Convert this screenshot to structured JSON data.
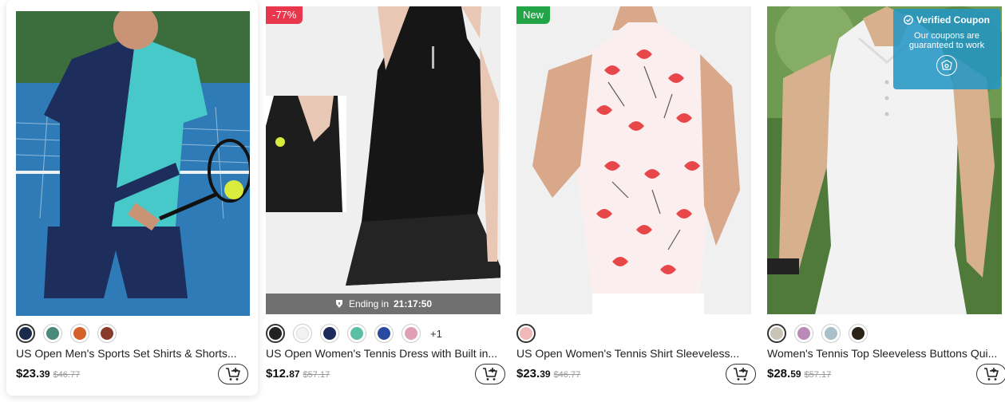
{
  "products": [
    {
      "title": "US Open Men's Sports Set Shirts & Shorts...",
      "price_int": "$23.",
      "price_dec": "39",
      "original_price": "$46.77",
      "swatch_colors": [
        "#1a2a4a",
        "#4a8a7a",
        "#d4602a",
        "#8a3a2a"
      ]
    },
    {
      "title": "US Open Women's Tennis Dress with Built in...",
      "price_int": "$12.",
      "price_dec": "87",
      "original_price": "$57.17",
      "badge": "-77%",
      "ending_label": "Ending in",
      "ending_time": "21:17:50",
      "swatch_colors": [
        "#222222",
        "#f2f2f2",
        "#1e2a5a",
        "#5abfa3",
        "#2a4aa0",
        "#e0a0b4"
      ],
      "more_colors": "+1"
    },
    {
      "title": "US Open Women's Tennis Shirt Sleeveless...",
      "price_int": "$23.",
      "price_dec": "39",
      "original_price": "$46.77",
      "badge": "New",
      "swatch_colors": [
        "#f0b8b8"
      ]
    },
    {
      "title": "Women's Tennis Top Sleeveless Buttons Qui...",
      "price_int": "$28.",
      "price_dec": "59",
      "original_price": "$57.17",
      "swatch_colors": [
        "#c8c4b8",
        "#b98ab8",
        "#a8c0c8",
        "#2a2418"
      ]
    }
  ],
  "coupon": {
    "title": "Verified Coupon",
    "subtitle_line1": "Our coupons are",
    "subtitle_line2": "guaranteed to work"
  },
  "icons": [
    "cart-add-icon",
    "clock-icon",
    "check-circle-icon",
    "shield-icon"
  ]
}
